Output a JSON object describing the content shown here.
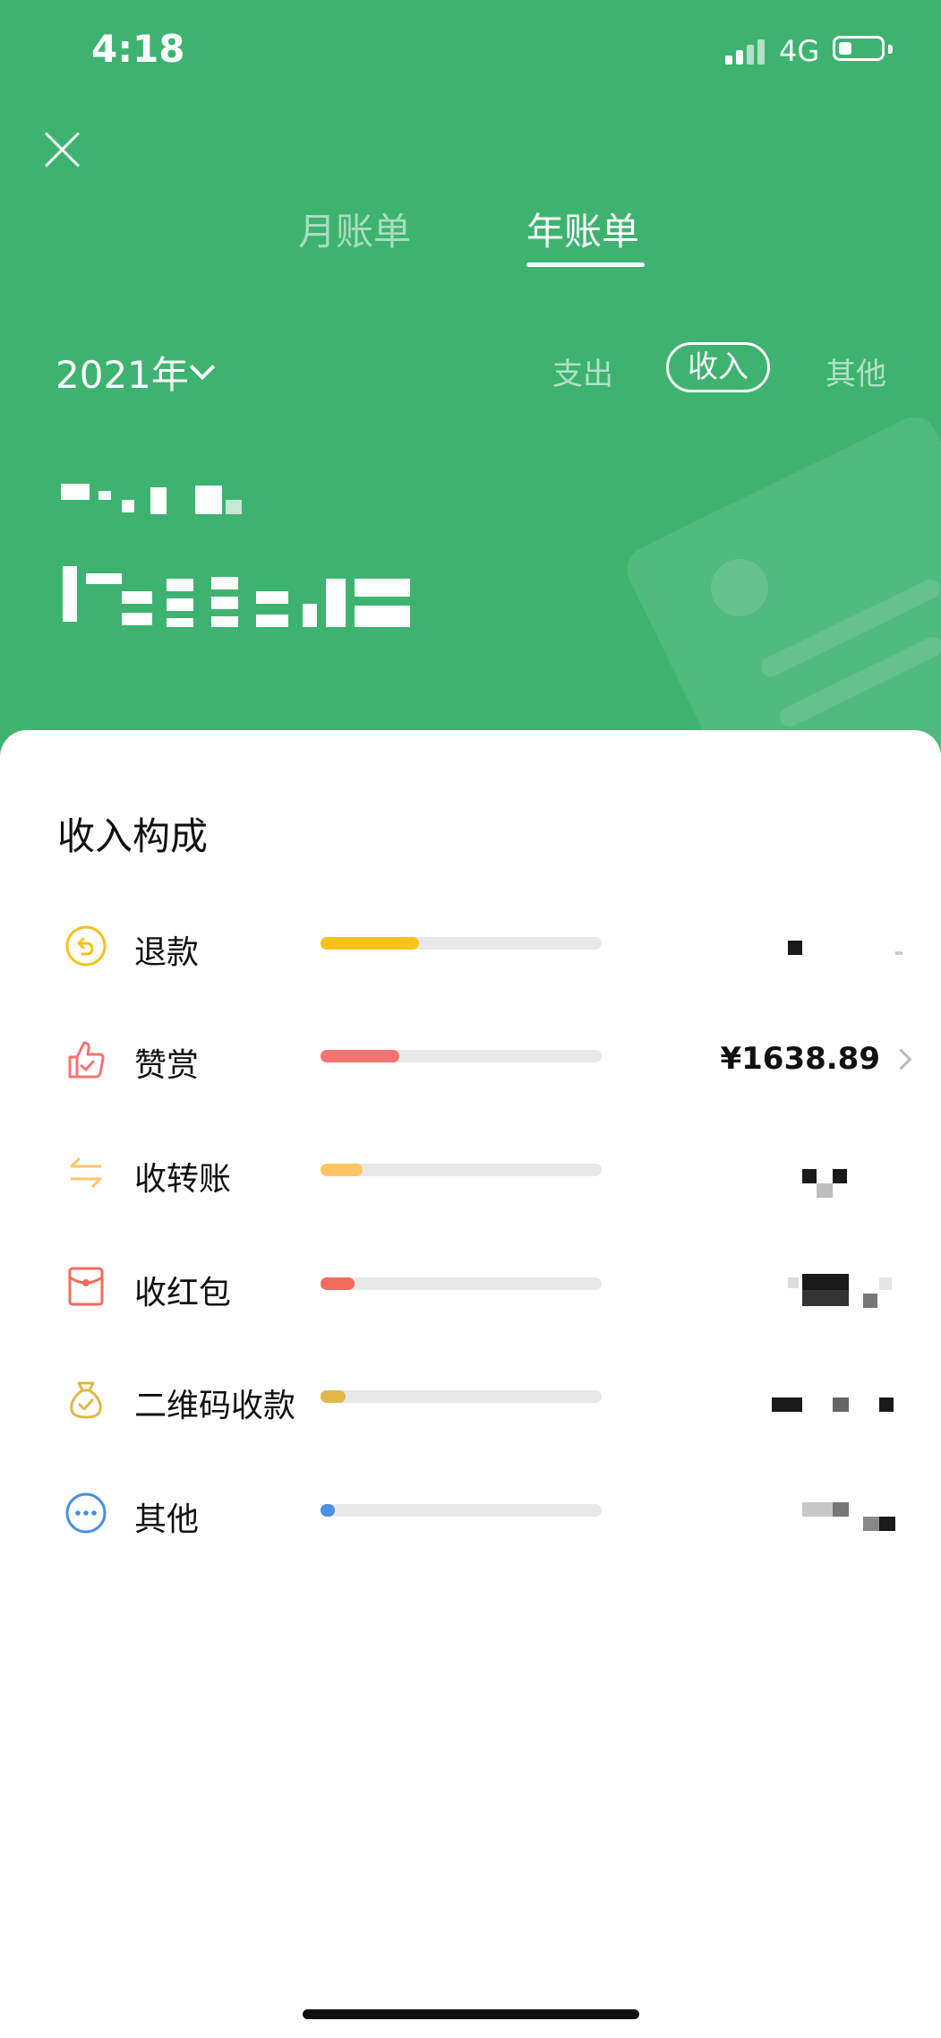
{
  "status": {
    "time": "4:18",
    "network": "4G"
  },
  "tabs": {
    "month": "月账单",
    "year": "年账单"
  },
  "year_select": "2021年",
  "filters": {
    "expense": "支出",
    "income": "收入",
    "other": "其他"
  },
  "section_title": "收入构成",
  "items": [
    {
      "label": "退款",
      "amount": "",
      "fill": 0.35,
      "color": "#f7c21a"
    },
    {
      "label": "赞赏",
      "amount": "¥1638.89",
      "fill": 0.28,
      "color": "#f47373"
    },
    {
      "label": "收转账",
      "amount": "",
      "fill": 0.15,
      "color": "#ffc565"
    },
    {
      "label": "收红包",
      "amount": "",
      "fill": 0.12,
      "color": "#f26b5b"
    },
    {
      "label": "二维码收款",
      "amount": "",
      "fill": 0.09,
      "color": "#e0b84a"
    },
    {
      "label": "其他",
      "amount": "",
      "fill": 0.05,
      "color": "#4a90e2"
    }
  ],
  "colors": {
    "header_green": "#3eb370"
  }
}
